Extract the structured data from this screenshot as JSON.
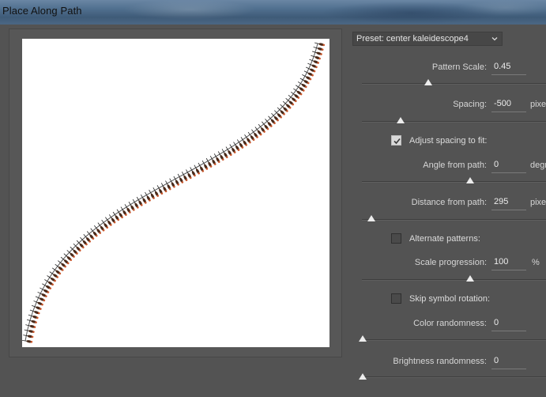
{
  "window": {
    "title": "Place Along Path"
  },
  "preset": {
    "label": "Preset: center kaleidescope4"
  },
  "controls": {
    "pattern_scale": {
      "label": "Pattern Scale:",
      "value": "0.45",
      "slider": 0.35
    },
    "spacing": {
      "label": "Spacing:",
      "value": "-500",
      "unit": "pixe",
      "slider": 0.2
    },
    "adjust_spacing": {
      "label": "Adjust spacing to fit:",
      "checked": true
    },
    "angle_from_path": {
      "label": "Angle from path:",
      "value": "0",
      "unit": "degr",
      "slider": 0.55
    },
    "distance_from_path": {
      "label": "Distance from path:",
      "value": "295",
      "unit": "pixe",
      "slider": 0.03
    },
    "alternate_patterns": {
      "label": "Alternate patterns:",
      "checked": false
    },
    "scale_progression": {
      "label": "Scale progression:",
      "value": "100",
      "unit": "%",
      "slider": 0.55
    },
    "skip_symbol_rotation": {
      "label": "Skip symbol rotation:",
      "checked": false
    },
    "color_randomness": {
      "label": "Color randomness:",
      "value": "0",
      "slider": 0.0
    },
    "brightness_randomness": {
      "label": "Brightness randomness:",
      "value": "0",
      "slider": 0.0
    }
  },
  "colors": {
    "background": "#535353",
    "preview": "#ffffff",
    "pattern_primary": "#4a2a1a",
    "pattern_accent": "#c8552a"
  }
}
